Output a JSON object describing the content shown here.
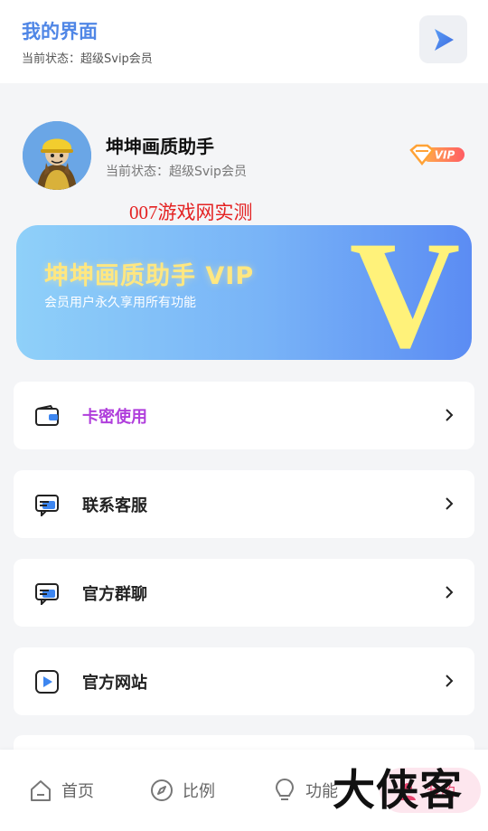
{
  "header": {
    "title": "我的界面",
    "status": "当前状态：超级Svip会员"
  },
  "profile": {
    "name": "坤坤画质助手",
    "status": "当前状态：超级Svip会员",
    "badge": "VIP"
  },
  "overlay_text": "007游戏网实测",
  "banner": {
    "title": "坤坤画质助手 VIP",
    "subtitle": "会员用户永久享用所有功能",
    "big_letter": "V"
  },
  "menu": [
    {
      "label": "卡密使用",
      "icon": "wallet-icon"
    },
    {
      "label": "联系客服",
      "icon": "chat-icon"
    },
    {
      "label": "官方群聊",
      "icon": "chat-icon"
    },
    {
      "label": "官方网站",
      "icon": "play-square-icon"
    }
  ],
  "nav": {
    "home": "首页",
    "ratio": "比例",
    "features": "功能",
    "mine": "我的"
  },
  "watermark": "大侠客",
  "colors": {
    "title_blue": "#4f86e6",
    "accent_purple": "#b03fdc",
    "banner_gold": "#ffe781",
    "active_pink": "#e8436e"
  }
}
